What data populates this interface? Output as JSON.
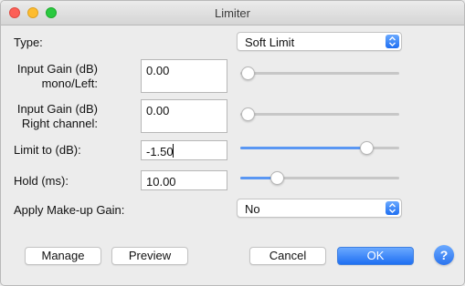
{
  "window": {
    "title": "Limiter"
  },
  "type": {
    "label": "Type:",
    "value": "Soft Limit"
  },
  "input_gain_left": {
    "label_line1": "Input Gain (dB)",
    "label_line2": "mono/Left:",
    "value": "0.00",
    "slider_level": 0.0
  },
  "input_gain_right": {
    "label_line1": "Input Gain (dB)",
    "label_line2": "Right channel:",
    "value": "0.00",
    "slider_level": 0.0
  },
  "limit_to": {
    "label": "Limit to (dB):",
    "value": "-1.50",
    "slider_level": 0.82
  },
  "hold": {
    "label": "Hold (ms):",
    "value": "10.00",
    "slider_level": 0.2
  },
  "makeup_gain": {
    "label": "Apply Make-up Gain:",
    "value": "No"
  },
  "buttons": {
    "manage": "Manage",
    "preview": "Preview",
    "cancel": "Cancel",
    "ok": "OK",
    "help": "?"
  },
  "colors": {
    "accent": "#1f6ff2",
    "slider_fill": "#5a97f3"
  }
}
